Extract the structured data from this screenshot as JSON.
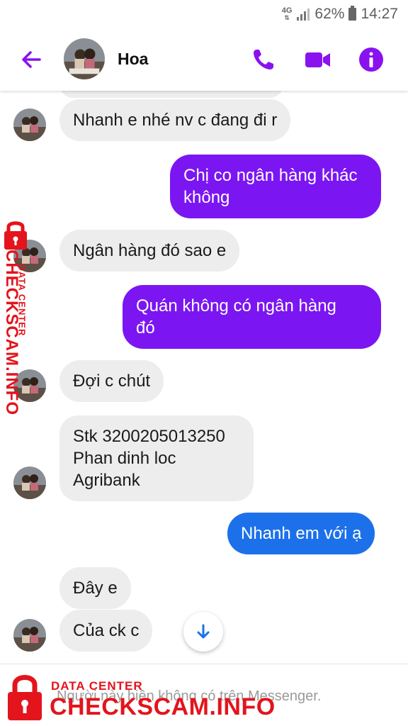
{
  "status_bar": {
    "network": "4G",
    "battery": "62%",
    "time": "14:27"
  },
  "header": {
    "title": "Hoa"
  },
  "messages": [
    {
      "text": "Nhanh e nhé nv c đang đi r"
    },
    {
      "text": "Chị co ngân hàng khác\nkhông"
    },
    {
      "text": "Ngân hàng đó sao e"
    },
    {
      "text": "Quán không có ngân hàng\nđó"
    },
    {
      "text": "Đợi c chút"
    },
    {
      "text": "Stk 3200205013250\nPhan dinh loc\nAgribank"
    },
    {
      "text": "Nhanh em với ạ"
    },
    {
      "text": "Đây e"
    },
    {
      "text": "Của ck c"
    }
  ],
  "footer": {
    "notice": "Người này hiện không có trên Messenger."
  },
  "watermark": {
    "label": "DATA CENTER",
    "site": "CHECKSCAM.INFO"
  },
  "colors": {
    "accent": "#7b16f2",
    "outgoing_bubble": "#7b16f2",
    "outgoing_bubble_alt": "#1c71ea",
    "incoming_bubble": "#ededee",
    "watermark": "#e3141c"
  }
}
